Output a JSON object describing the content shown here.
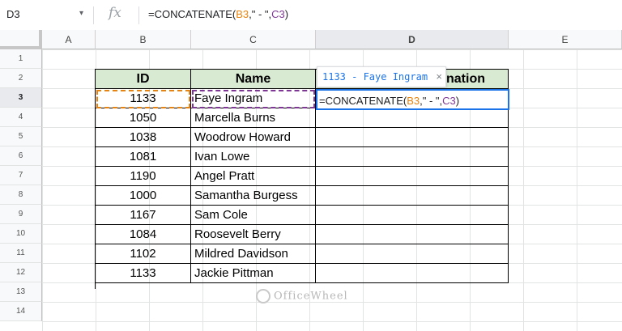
{
  "formula_bar": {
    "cell_ref": "D3",
    "fx_label": "fx",
    "formula_prefix": "=CONCATENATE(",
    "formula_ref1": "B3",
    "formula_middle": ",\" - \",",
    "formula_ref2": "C3",
    "formula_suffix": ")"
  },
  "columns": [
    "A",
    "B",
    "C",
    "D",
    "E"
  ],
  "rows": [
    "1",
    "2",
    "3",
    "4",
    "5",
    "6",
    "7",
    "8",
    "9",
    "10",
    "11",
    "12",
    "13",
    "14"
  ],
  "table": {
    "headers": {
      "id": "ID",
      "name": "Name",
      "combo_suffix": "nation"
    },
    "records": [
      {
        "id": "1133",
        "name": "Faye Ingram"
      },
      {
        "id": "1050",
        "name": "Marcella Burns"
      },
      {
        "id": "1038",
        "name": "Woodrow Howard"
      },
      {
        "id": "1081",
        "name": "Ivan Lowe"
      },
      {
        "id": "1190",
        "name": "Angel Pratt"
      },
      {
        "id": "1000",
        "name": "Samantha Burgess"
      },
      {
        "id": "1167",
        "name": "Sam Cole"
      },
      {
        "id": "1084",
        "name": "Roosevelt Berry"
      },
      {
        "id": "1102",
        "name": "Mildred Davidson"
      },
      {
        "id": "1133",
        "name": "Jackie Pittman"
      }
    ]
  },
  "tooltip": {
    "preview": "1133 - Faye Ingram",
    "close": "×"
  },
  "editing": {
    "prefix": "=CONCATENATE(",
    "ref1": "B3",
    "middle": ",\" - \",",
    "ref2": "C3",
    "suffix": ")"
  },
  "watermark": "OfficeWheel",
  "colors": {
    "header_bg": "#d9ead3",
    "ref_orange": "#e8830f",
    "ref_purple": "#7e3794",
    "active_blue": "#1a73e8"
  }
}
